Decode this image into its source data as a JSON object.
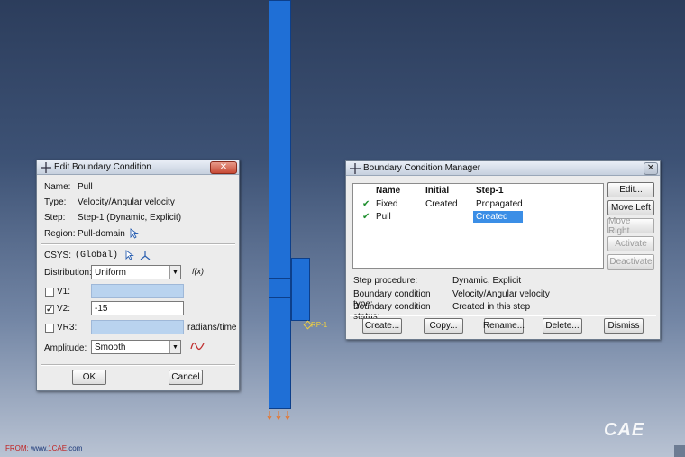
{
  "edit_dialog": {
    "title": "Edit Boundary Condition",
    "close_label": "✕",
    "name_label": "Name:",
    "name_value": "Pull",
    "type_label": "Type:",
    "type_value": "Velocity/Angular velocity",
    "step_label": "Step:",
    "step_value": "Step-1 (Dynamic, Explicit)",
    "region_label": "Region:",
    "region_value": "Pull-domain",
    "csys_label": "CSYS:",
    "csys_value": "(Global)",
    "distribution_label": "Distribution:",
    "distribution_value": "Uniform",
    "fx_label": "f(x)",
    "v1_label": "V1:",
    "v1_checked": false,
    "v1_value": "",
    "v2_label": "V2:",
    "v2_checked": true,
    "v2_value": "-15",
    "vr3_label": "VR3:",
    "vr3_checked": false,
    "vr3_value": "",
    "vr3_unit": "radians/time",
    "amplitude_label": "Amplitude:",
    "amplitude_value": "Smooth",
    "ok_label": "OK",
    "cancel_label": "Cancel"
  },
  "manager_dialog": {
    "title": "Boundary Condition Manager",
    "close_label": "✕",
    "columns": [
      "Name",
      "Initial",
      "Step-1"
    ],
    "rows": [
      {
        "check": "✔",
        "name": "Fixed",
        "initial": "Created",
        "step1": "Propagated",
        "selected": false
      },
      {
        "check": "✔",
        "name": "Pull",
        "initial": "",
        "step1": "Created",
        "selected": true
      }
    ],
    "side_buttons": {
      "edit": "Edit...",
      "move_left": "Move Left",
      "move_right": "Move Right",
      "activate": "Activate",
      "deactivate": "Deactivate"
    },
    "info": {
      "step_procedure_label": "Step procedure:",
      "step_procedure_value": "Dynamic, Explicit",
      "bc_type_label": "Boundary condition type:",
      "bc_type_value": "Velocity/Angular velocity",
      "bc_status_label": "Boundary condition status:",
      "bc_status_value": "Created in this step"
    },
    "bottom_buttons": {
      "create": "Create...",
      "copy": "Copy...",
      "rename": "Rename...",
      "delete": "Delete...",
      "dismiss": "Dismiss"
    }
  },
  "viewport": {
    "rp_label": "RP-1",
    "watermark_from": "FROM:",
    "watermark_url_prefix": "www.",
    "watermark_url_brand": "1CAE",
    "watermark_url_suffix": ".com",
    "watermark_logo": "CAE",
    "model_color": "#1f6fd6",
    "background_top": "#2c3d5c",
    "background_bottom": "#b9c3d3"
  }
}
